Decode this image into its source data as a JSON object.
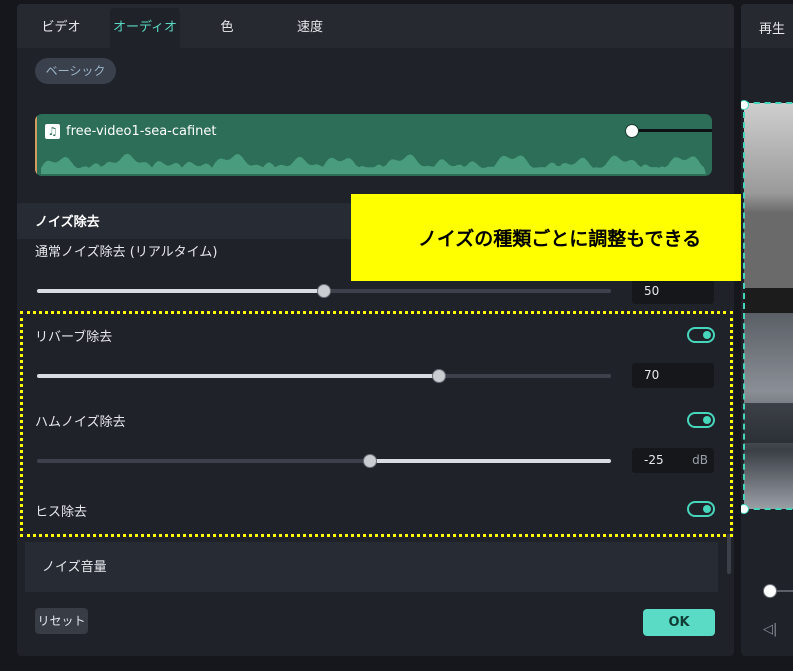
{
  "tabs": [
    {
      "label": "ビデオ",
      "active": false
    },
    {
      "label": "オーディオ",
      "active": true
    },
    {
      "label": "色",
      "active": false
    },
    {
      "label": "速度",
      "active": false
    }
  ],
  "basic_button": "ベーシック",
  "audio_clip": {
    "name": "free-video1-sea-cafinet",
    "icon": "music-note-icon"
  },
  "section": {
    "title": "ノイズ除去",
    "normal": {
      "label": "通常ノイズ除去 (リアルタイム)",
      "value": "50",
      "level": 0.5
    },
    "reverb": {
      "label": "リバーブ除去",
      "value": "70",
      "level": 0.7,
      "enabled": true
    },
    "hum": {
      "label": "ハムノイズ除去",
      "value": "-25",
      "unit": "dB",
      "level": 0.58,
      "enabled": true
    },
    "hiss": {
      "label": "ヒス除去",
      "enabled": true
    }
  },
  "annotation": "ノイズの種類ごとに調整もできる",
  "noise_volume_label": "ノイズ音量",
  "buttons": {
    "reset": "リセット",
    "ok": "OK"
  },
  "preview": {
    "title": "再生"
  },
  "colors": {
    "accent": "#5adbc5",
    "clip": "#2c6e57",
    "annotation": "#ffff00",
    "panel": "#1f2229"
  }
}
